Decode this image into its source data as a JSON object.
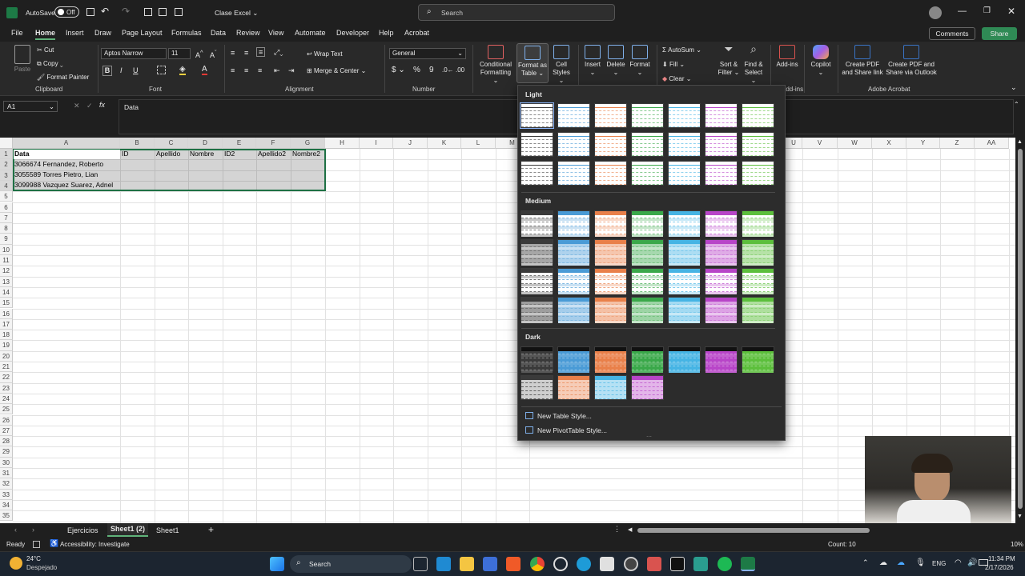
{
  "titlebar": {
    "autosave": "AutoSave",
    "autosave_state": "Off",
    "doc_title": "Clase Excel",
    "search_placeholder": "Search"
  },
  "menu": [
    "File",
    "Home",
    "Insert",
    "Draw",
    "Page Layout",
    "Formulas",
    "Data",
    "Review",
    "View",
    "Automate",
    "Developer",
    "Help",
    "Acrobat"
  ],
  "menu_right": {
    "comments": "Comments",
    "share": "Share"
  },
  "ribbon": {
    "paste": "Paste",
    "cut": "Cut",
    "copy": "Copy",
    "format_painter": "Format Painter",
    "clipboard": "Clipboard",
    "font_name": "Aptos Narrow",
    "font_size": "11",
    "font_group": "Font",
    "wrap_text": "Wrap Text",
    "merge_center": "Merge & Center",
    "alignment": "Alignment",
    "number_format": "General",
    "number": "Number",
    "cond_format_1": "Conditional",
    "cond_format_2": "Formatting",
    "format_table_1": "Format as",
    "format_table_2": "Table",
    "cell_styles_1": "Cell",
    "cell_styles_2": "Styles",
    "insert": "Insert",
    "delete": "Delete",
    "format": "Format",
    "autosum": "AutoSum",
    "fill": "Fill",
    "clear": "Clear",
    "sort_1": "Sort &",
    "sort_2": "Filter",
    "find_1": "Find &",
    "find_2": "Select",
    "addins": "Add-ins",
    "addins_group": "Add-ins",
    "copilot": "Copilot",
    "pdf1_1": "Create PDF",
    "pdf1_2": "and Share link",
    "pdf2_1": "Create PDF and",
    "pdf2_2": "Share via Outlook",
    "acrobat_group": "Adobe Acrobat"
  },
  "formula": {
    "name_box": "A1",
    "fx": "fx",
    "content": "Data"
  },
  "columns": [
    "A",
    "B",
    "C",
    "D",
    "E",
    "F",
    "G",
    "H",
    "I",
    "J",
    "K",
    "L",
    "M",
    "U",
    "V",
    "W",
    "X",
    "Y",
    "Z",
    "AA"
  ],
  "rows": [
    "1",
    "2",
    "3",
    "4",
    "5",
    "6",
    "7",
    "8",
    "9",
    "10",
    "11",
    "12",
    "13",
    "14",
    "15",
    "16",
    "17",
    "18",
    "19",
    "20",
    "21",
    "22",
    "23",
    "24",
    "25",
    "26",
    "27",
    "28",
    "29",
    "30",
    "31",
    "32",
    "33",
    "34",
    "35"
  ],
  "cells": {
    "A1": "Data",
    "B1": "ID",
    "C1": "Apellido",
    "D1": "Nombre",
    "E1": "ID2",
    "F1": "Apellido2",
    "G1": "Nombre2",
    "A2": "3066674 Fernandez, Roberto",
    "A3": "3055589 Torres Pietro, Lian",
    "A4": "3099988 Vazquez Suarez, Adnel"
  },
  "gallery": {
    "light": "Light",
    "medium": "Medium",
    "dark": "Dark",
    "new_table_style": "New Table Style...",
    "new_pivot_style": "New PivotTable Style..."
  },
  "palette": {
    "black": "#3a3a3a",
    "blue": "#4a9bd6",
    "orange": "#e9804a",
    "green": "#3aa84a",
    "cyan": "#46b4e4",
    "purple": "#b845c8",
    "lime": "#5cbf3c"
  },
  "sheets": [
    "Ejercicios",
    "Sheet1 (2)",
    "Sheet1"
  ],
  "status": {
    "ready": "Ready",
    "accessibility": "Accessibility: Investigate",
    "count": "Count: 10",
    "zoom": "10%"
  },
  "taskbar": {
    "temp": "24°C",
    "weather": "Despejado",
    "search": "Search",
    "lang": "ENG",
    "time": "11:34 PM",
    "date": "2/17/2026"
  }
}
